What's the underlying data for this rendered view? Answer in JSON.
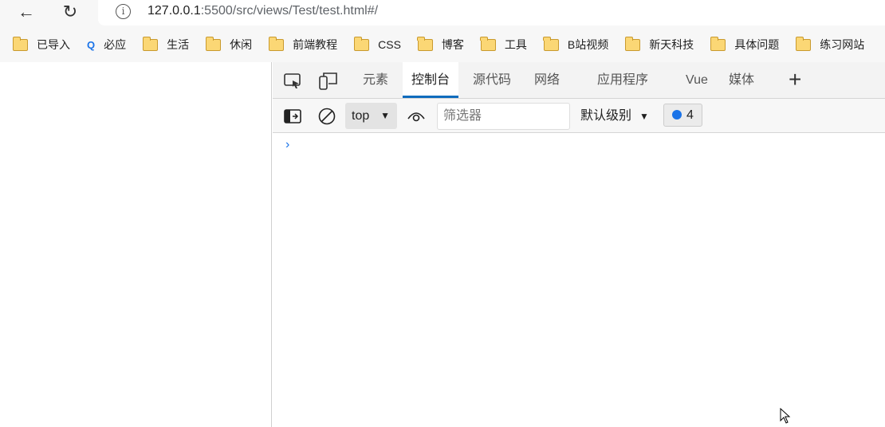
{
  "browser": {
    "url_host": "127.0.0.1",
    "url_rest": ":5500/src/views/Test/test.html#/"
  },
  "bookmarks": [
    {
      "label": "已导入",
      "icon": "folder-icon"
    },
    {
      "label": "必应",
      "icon": "search-icon"
    },
    {
      "label": "生活",
      "icon": "folder-icon"
    },
    {
      "label": "休闲",
      "icon": "folder-icon"
    },
    {
      "label": "前端教程",
      "icon": "folder-icon"
    },
    {
      "label": "CSS",
      "icon": "folder-icon"
    },
    {
      "label": "博客",
      "icon": "folder-icon"
    },
    {
      "label": "工具",
      "icon": "folder-icon"
    },
    {
      "label": "B站视频",
      "icon": "folder-icon"
    },
    {
      "label": "新天科技",
      "icon": "folder-icon"
    },
    {
      "label": "具体问题",
      "icon": "folder-icon"
    },
    {
      "label": "练习网站",
      "icon": "folder-icon"
    }
  ],
  "devtools": {
    "tabs": [
      "元素",
      "控制台",
      "源代码",
      "网络",
      "应用程序",
      "Vue",
      "媒体"
    ],
    "active_tab": "控制台",
    "context": "top",
    "filter_placeholder": "筛选器",
    "level": "默认级别",
    "message_count": "4",
    "accent": "#0f6cbd"
  }
}
